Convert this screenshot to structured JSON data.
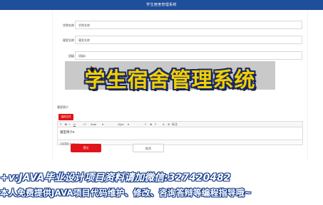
{
  "app": {
    "title": "学生宿舍管理系统"
  },
  "form": {
    "fields": [
      {
        "label": "学院名称",
        "value": "学院名称"
      },
      {
        "label": "寝室名称",
        "value": "寝室名称"
      },
      {
        "label": "班级",
        "value": "班级5"
      },
      {
        "label": "封面",
        "value": ""
      }
    ],
    "editor": {
      "label": "寝室简介",
      "upload_label": "选择文件",
      "toolbar": [
        "≡",
        "B",
        "I",
        "U",
        "☐",
        "Arial",
        "▾",
        "16px",
        "▾",
        "≡",
        "≣",
        "≡",
        "A",
        "⊕",
        "标注"
      ],
      "content": "寝室简介5",
      "status": "元素路径: body > p"
    },
    "submit_label": "提交",
    "cancel_label": "取消"
  },
  "banner": {
    "text": "学生宿舍管理系统"
  },
  "overlay": {
    "line1": "+v:JAVA毕业设计项目资料请加微信:327420482",
    "line2": "本人免费提供JAVA项目代码维护、修改、咨询答辩等编程指导哦~"
  },
  "colors": {
    "header": "#1f4e9a",
    "primary_button": "#e0141a",
    "banner_text": "#f3cf00",
    "banner_outline": "#1a2a63"
  }
}
